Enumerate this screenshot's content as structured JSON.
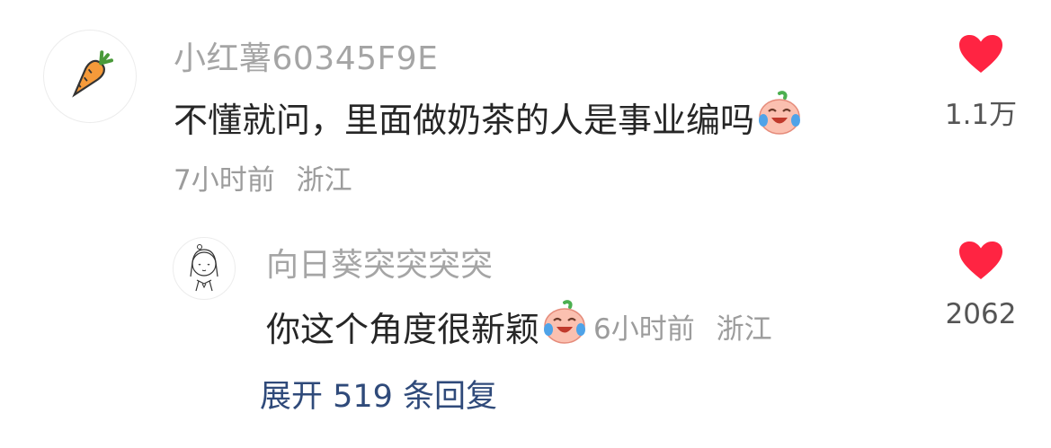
{
  "comment": {
    "username": "小红薯60345F9E",
    "avatar_icon": "carrot-icon",
    "text": "不懂就问，里面做奶茶的人是事业编吗",
    "emoji": "crying-laughing-peach-emoji",
    "time": "7小时前",
    "location": "浙江",
    "like_icon": "heart-icon",
    "like_count": "1.1万",
    "like_color": "#ff2442"
  },
  "reply": {
    "username": "向日葵突突突突",
    "avatar_icon": "sketch-girl-avatar-icon",
    "text": "你这个角度很新颖",
    "emoji": "crying-laughing-peach-emoji",
    "time": "6小时前",
    "location": "浙江",
    "like_icon": "heart-icon",
    "like_count": "2062",
    "like_color": "#ff2442"
  },
  "expand_label": "展开 519 条回复",
  "expand_color": "#2f4a7a"
}
